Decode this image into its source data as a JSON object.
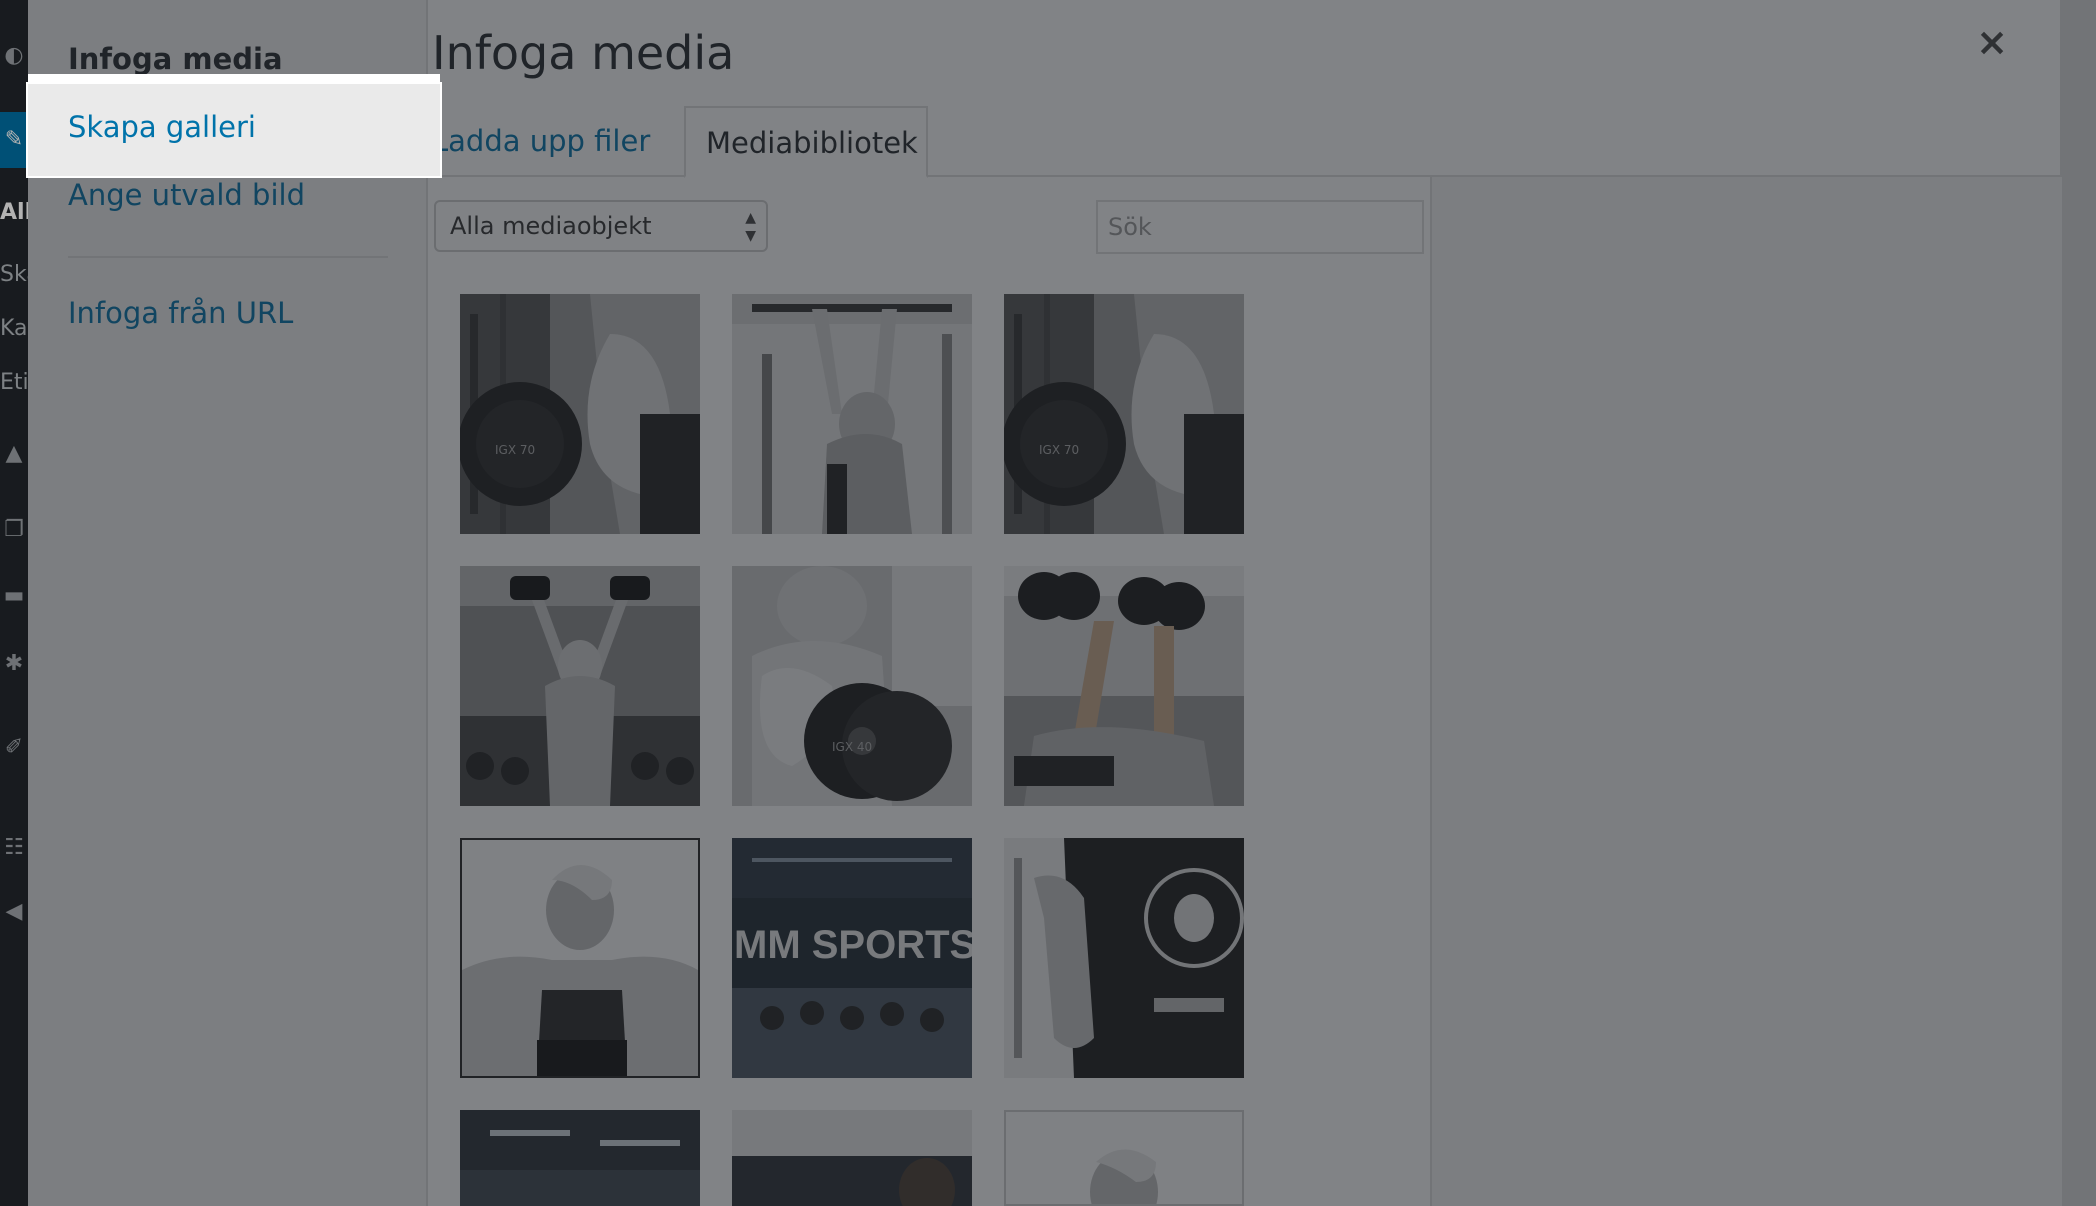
{
  "admin_sidebar": {
    "items": [
      "All",
      "Ska",
      "Kat",
      "Etik"
    ]
  },
  "menu": {
    "heading": "Infoga media",
    "create_gallery": "Skapa galleri",
    "featured_image": "Ange utvald bild",
    "insert_from_url": "Infoga från URL"
  },
  "modal": {
    "title": "Infoga media",
    "close": "×"
  },
  "tabs": {
    "upload": "Ladda upp filer",
    "library": "Mediabibliotek"
  },
  "toolbar": {
    "filter_selected": "Alla mediaobjekt",
    "search_placeholder": "Sök"
  },
  "thumbnails": [
    {
      "alt": "Man doing bicep curl with dumbbell IGX 70"
    },
    {
      "alt": "Man doing lat pulldown"
    },
    {
      "alt": "Man doing bicep curl with dumbbell IGX 70"
    },
    {
      "alt": "Man doing overhead dumbbell press in gym"
    },
    {
      "alt": "Man doing bicep curl with dumbbell IGX 40"
    },
    {
      "alt": "Man doing incline dumbbell press"
    },
    {
      "alt": "Woman back and shoulders"
    },
    {
      "alt": "MM SPORTS gym crowd"
    },
    {
      "alt": "Man in black t-shirt with skull logo"
    },
    {
      "alt": "Gym ceiling lights"
    },
    {
      "alt": "Man portrait"
    },
    {
      "alt": "Woman portrait"
    }
  ],
  "image_text": {
    "dumbbell_a": "IGX 70",
    "dumbbell_b": "IGX 40",
    "banner": "MM SPORTS"
  }
}
